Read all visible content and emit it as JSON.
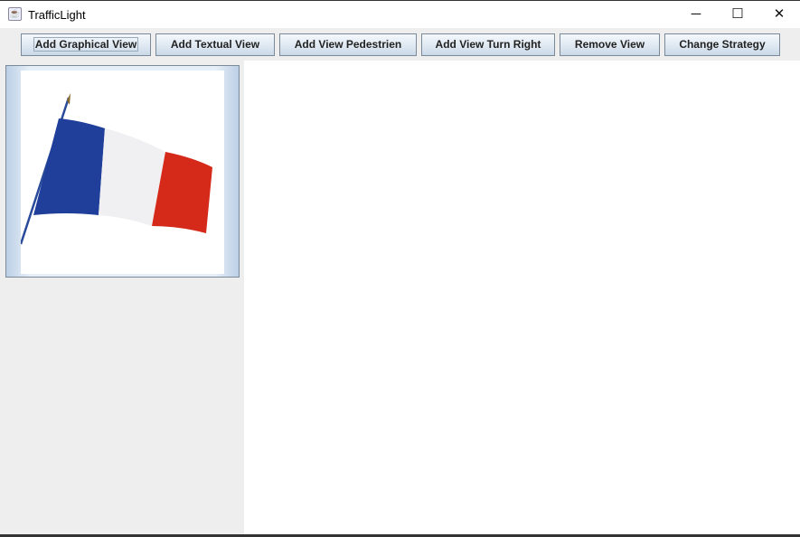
{
  "window": {
    "title": "TrafficLight",
    "icon": "java-icon",
    "minimize": "─",
    "maximize": "☐",
    "close": "✕"
  },
  "toolbar": {
    "buttons": [
      "Add Graphical View",
      "Add Textual View",
      "Add View Pedestrien",
      "Add View Turn Right",
      "Remove View",
      "Change Strategy"
    ]
  },
  "views": [
    {
      "type": "graphical",
      "image": "french-flag"
    }
  ],
  "colors": {
    "blue": "#1f3f9a",
    "white": "#f2f2f2",
    "red": "#d52a1a"
  }
}
